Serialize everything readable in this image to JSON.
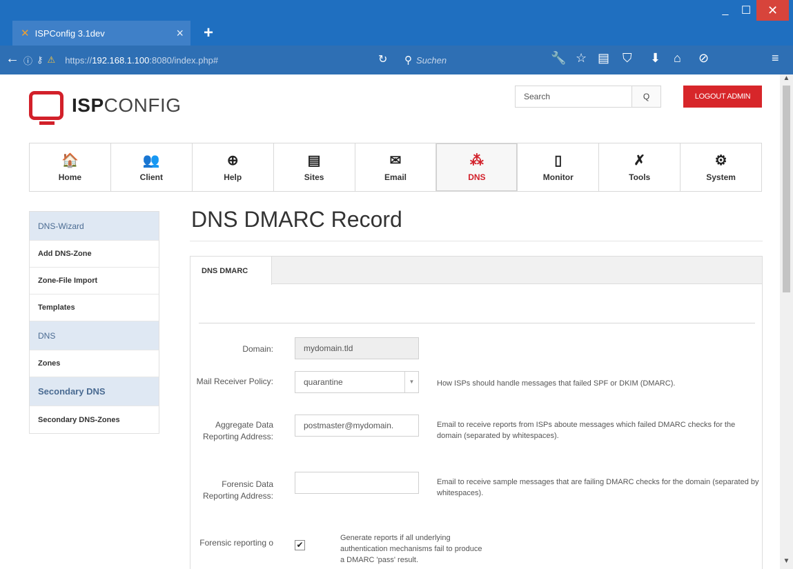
{
  "browser": {
    "tab_title": "ISPConfig 3.1dev",
    "tab_close": "×",
    "new_tab": "+",
    "url_prefix": "https://",
    "url_host": "192.168.1.100",
    "url_rest": ":8080/index.php#",
    "search_placeholder": "Suchen",
    "window_min": "_",
    "window_max": "☐",
    "window_close": "✕"
  },
  "header": {
    "logo_bold": "ISP",
    "logo_light": "CONFIG",
    "search_placeholder": "Search",
    "search_button": "Q",
    "logout_label": "LOGOUT ADMIN"
  },
  "mainnav": [
    {
      "label": "Home",
      "icon": "home-icon",
      "glyph": "🏠"
    },
    {
      "label": "Client",
      "icon": "users-icon",
      "glyph": "👥"
    },
    {
      "label": "Help",
      "icon": "lifebuoy-icon",
      "glyph": "⊕"
    },
    {
      "label": "Sites",
      "icon": "sites-icon",
      "glyph": "▤"
    },
    {
      "label": "Email",
      "icon": "email-icon",
      "glyph": "✉"
    },
    {
      "label": "DNS",
      "icon": "dns-icon",
      "glyph": "⁂"
    },
    {
      "label": "Monitor",
      "icon": "monitor-icon",
      "glyph": "▯"
    },
    {
      "label": "Tools",
      "icon": "tools-icon",
      "glyph": "✗"
    },
    {
      "label": "System",
      "icon": "gear-icon",
      "glyph": "⚙"
    }
  ],
  "active_nav": "DNS",
  "sidebar": {
    "dns_wizard": "DNS-Wizard",
    "add_dns_zone": "Add DNS-Zone",
    "zone_file_import": "Zone-File Import",
    "templates": "Templates",
    "dns": "DNS",
    "zones": "Zones",
    "secondary_dns": "Secondary DNS",
    "secondary_dns_zones": "Secondary DNS-Zones"
  },
  "page_title": "DNS DMARC Record",
  "panel_tab": "DNS DMARC",
  "form": {
    "domain_label": "Domain:",
    "domain_value": "mydomain.tld",
    "policy_label": "Mail Receiver Policy:",
    "policy_value": "quarantine",
    "policy_help": "How ISPs should handle messages that failed SPF or DKIM (DMARC).",
    "aggregate_label": "Aggregate Data Reporting Address:",
    "aggregate_value": "postmaster@mydomain.",
    "aggregate_help": "Email to receive reports from ISPs aboute messages which failed DMARC checks for the domain (separated by whitespaces).",
    "forensic_label": "Forensic Data Reporting Address:",
    "forensic_value": "",
    "forensic_help": "Email to receive sample messages that are failing DMARC checks for the domain (separated by whitespaces).",
    "forensic_options_label": "Forensic reporting o",
    "forensic_option_checked": true,
    "forensic_option_help": "Generate reports if all underlying authentication mechanisms fail to produce a DMARC 'pass' result."
  }
}
